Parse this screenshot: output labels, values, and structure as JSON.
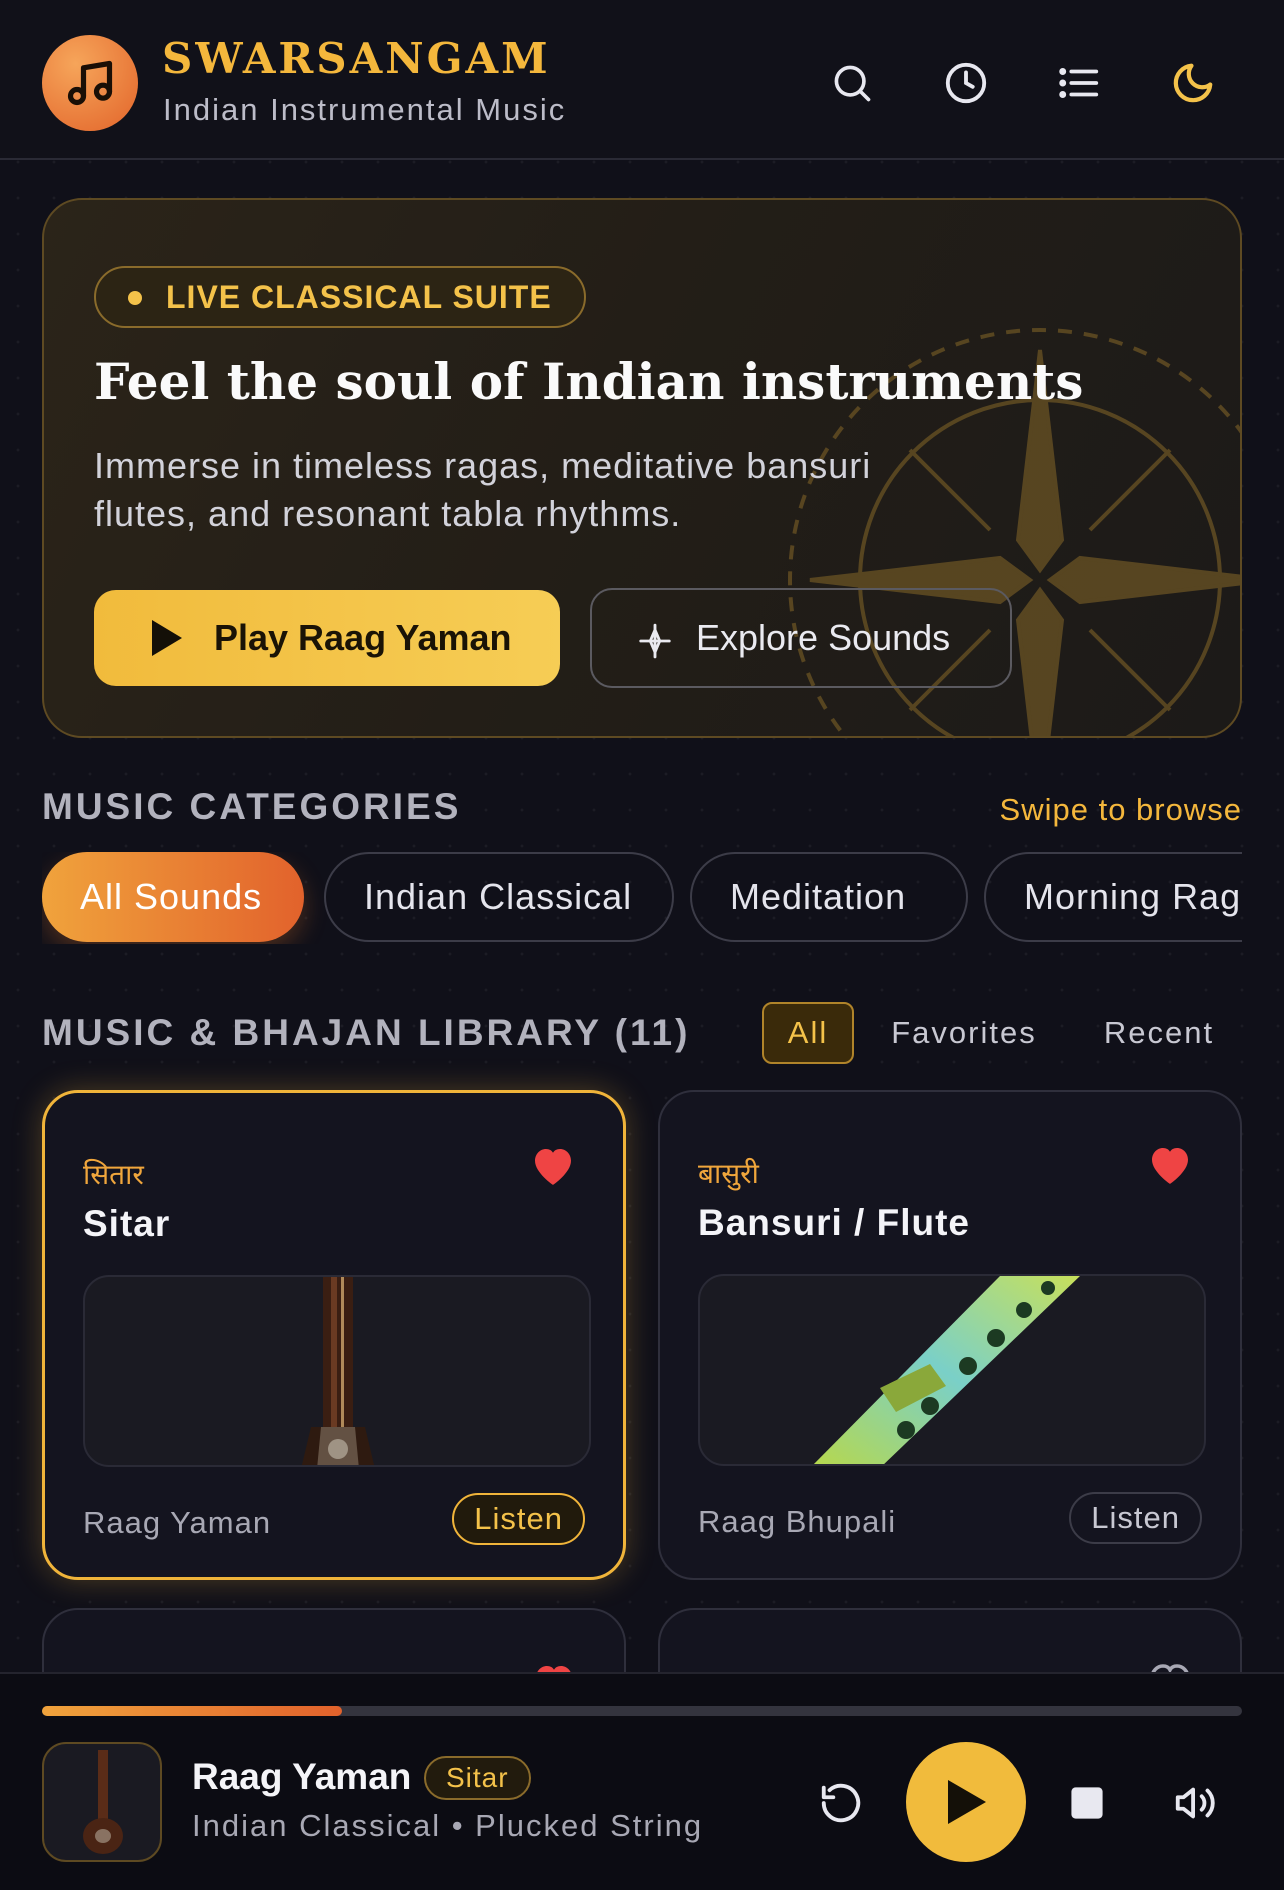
{
  "header": {
    "brand": "SWARSANGAM",
    "tagline": "Indian Instrumental Music",
    "icons": [
      "search-icon",
      "history-icon",
      "list-icon",
      "moon-icon"
    ]
  },
  "hero": {
    "badge": "LIVE CLASSICAL SUITE",
    "title": "Feel the soul of Indian instruments",
    "description": "Immerse in timeless ragas, meditative bansuri flutes, and resonant tabla rhythms.",
    "primary_button": "Play Raag Yaman",
    "secondary_button": "Explore Sounds"
  },
  "categories": {
    "title": "MUSIC CATEGORIES",
    "hint": "Swipe to browse",
    "chips": [
      {
        "label": "All Sounds",
        "active": true
      },
      {
        "label": "Indian Classical",
        "active": false
      },
      {
        "label": "Meditation",
        "active": false
      },
      {
        "label": "Morning Rag",
        "active": false
      }
    ]
  },
  "library": {
    "title": "MUSIC & BHAJAN LIBRARY (11)",
    "tabs": [
      {
        "label": "All",
        "active": true
      },
      {
        "label": "Favorites",
        "active": false
      },
      {
        "label": "Recent",
        "active": false
      }
    ],
    "cards": [
      {
        "native": "सितार",
        "name": "Sitar",
        "raag": "Raag Yaman",
        "listen": "Listen",
        "favorite": true,
        "selected": true,
        "image": "sitar-image"
      },
      {
        "native": "बासुरी",
        "name": "Bansuri / Flute",
        "raag": "Raag Bhupali",
        "listen": "Listen",
        "favorite": true,
        "selected": false,
        "image": "flute-image"
      }
    ]
  },
  "player": {
    "title": "Raag Yaman",
    "tag": "Sitar",
    "subtitle": "Indian Classical • Plucked String",
    "progress": 0.25
  },
  "colors": {
    "accent_gold": "#f1bb3c",
    "accent_orange": "#e2622c",
    "heart": "#ef4444",
    "background": "#101019"
  }
}
